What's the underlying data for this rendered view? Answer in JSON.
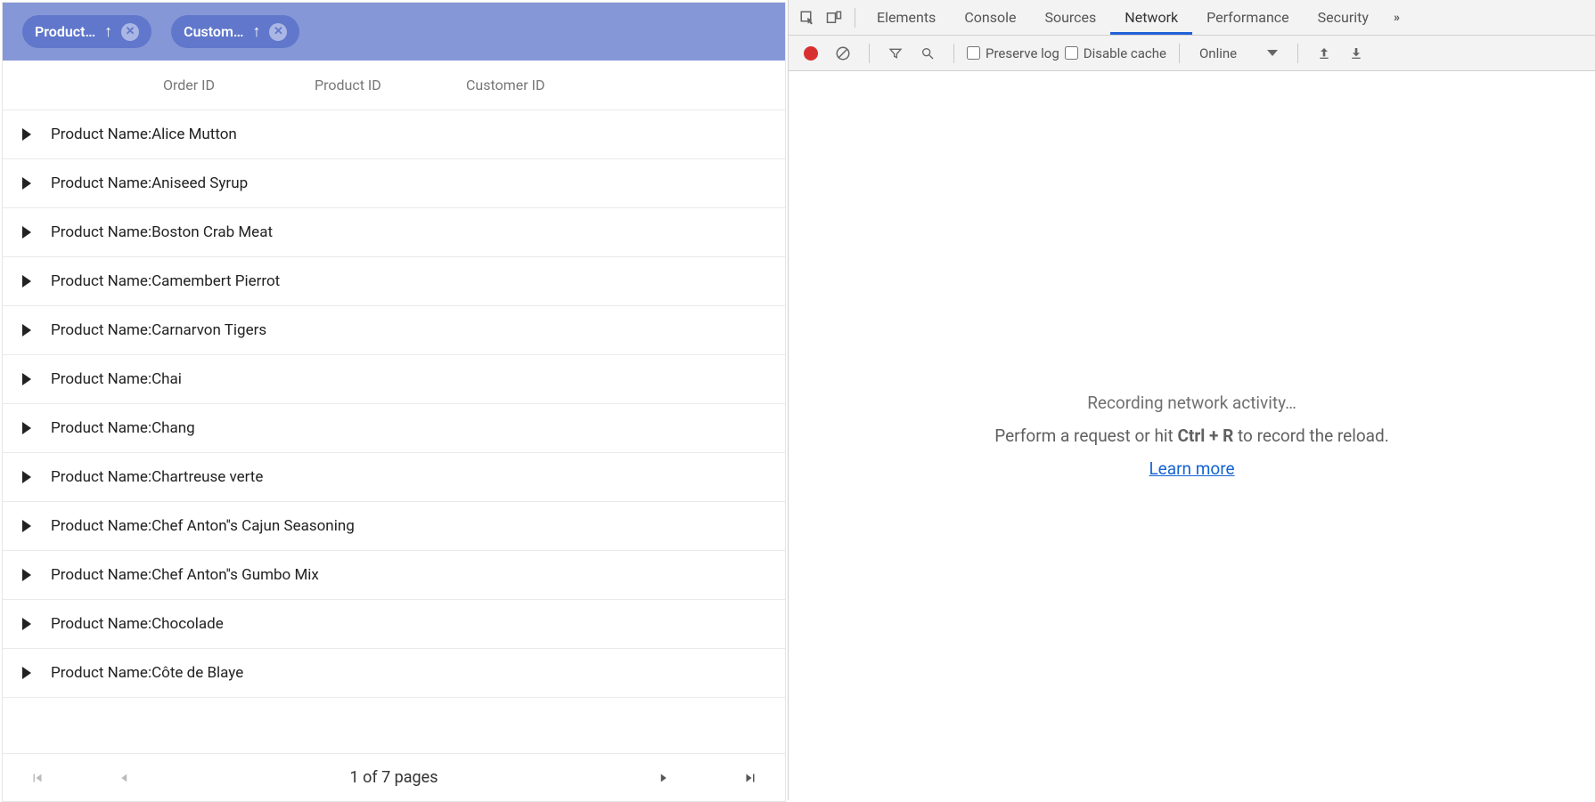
{
  "grid": {
    "group_chips": [
      {
        "label": "Product…",
        "arrow": "↑"
      },
      {
        "label": "Custom…",
        "arrow": "↑"
      }
    ],
    "columns": [
      "Order ID",
      "Product ID",
      "Customer ID"
    ],
    "group_label_prefix": "Product Name: ",
    "groups": [
      "Alice Mutton",
      "Aniseed Syrup",
      "Boston Crab Meat",
      "Camembert Pierrot",
      "Carnarvon Tigers",
      "Chai",
      "Chang",
      "Chartreuse verte",
      "Chef Anton''s Cajun Seasoning",
      "Chef Anton''s Gumbo Mix",
      "Chocolade",
      "Côte de Blaye"
    ],
    "pager_text": "1 of 7 pages"
  },
  "devtools": {
    "tabs": [
      "Elements",
      "Console",
      "Sources",
      "Network",
      "Performance",
      "Security"
    ],
    "active_tab": "Network",
    "preserve_log_label": "Preserve log",
    "disable_cache_label": "Disable cache",
    "throttle_value": "Online",
    "body_title": "Recording network activity…",
    "body_sub_prefix": "Perform a request or hit ",
    "body_sub_key": "Ctrl + R",
    "body_sub_suffix": " to record the reload.",
    "learn_more": "Learn more"
  }
}
